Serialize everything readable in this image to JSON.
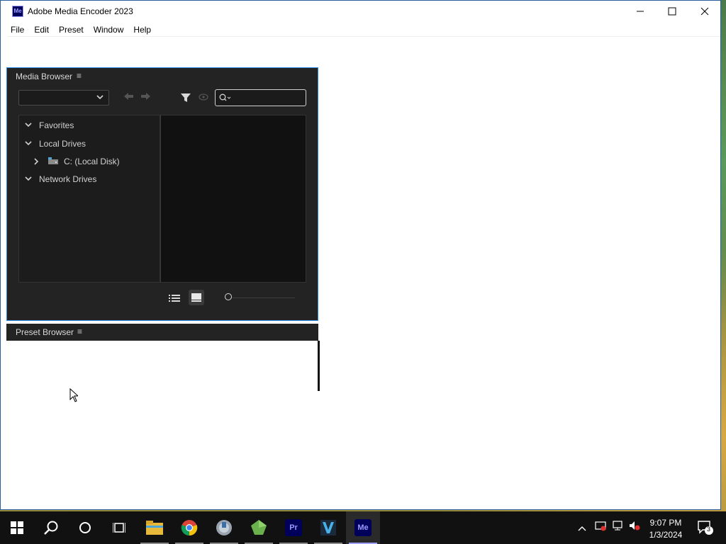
{
  "window": {
    "title": "Adobe Media Encoder 2023",
    "app_icon_text": "Me",
    "minimize_label": "—",
    "maximize_label": "☐",
    "close_label": "✕"
  },
  "menu": [
    {
      "label": "File"
    },
    {
      "label": "Edit"
    },
    {
      "label": "Preset"
    },
    {
      "label": "Window"
    },
    {
      "label": "Help"
    }
  ],
  "media_browser": {
    "title": "Media Browser",
    "menu_glyph": "≡",
    "search": {
      "value": "",
      "placeholder": ""
    },
    "tree": [
      {
        "label": "Favorites",
        "expanded": true
      },
      {
        "label": "Local Drives",
        "expanded": true
      },
      {
        "label": "C: (Local Disk)",
        "expanded": false
      },
      {
        "label": "Network Drives",
        "expanded": true
      }
    ]
  },
  "preset_browser": {
    "title": "Preset Browser",
    "menu_glyph": "≡"
  },
  "taskbar": {
    "apps": [
      "start",
      "search",
      "cortana",
      "task-view",
      "file-explorer",
      "chrome",
      "media-app",
      "green-app",
      "premiere-pro",
      "vlc",
      "media-encoder"
    ],
    "premiere_label": "Pr",
    "encoder_label": "Me",
    "clock_time": "9:07 PM",
    "clock_date": "1/3/2024",
    "notification_count": "3"
  },
  "colors": {
    "panel_bg": "#232323",
    "focus_border": "#2d8ceb",
    "premiere_bg": "#00005b",
    "premiere_fg": "#9999ff",
    "encoder_bg": "#00005b"
  }
}
